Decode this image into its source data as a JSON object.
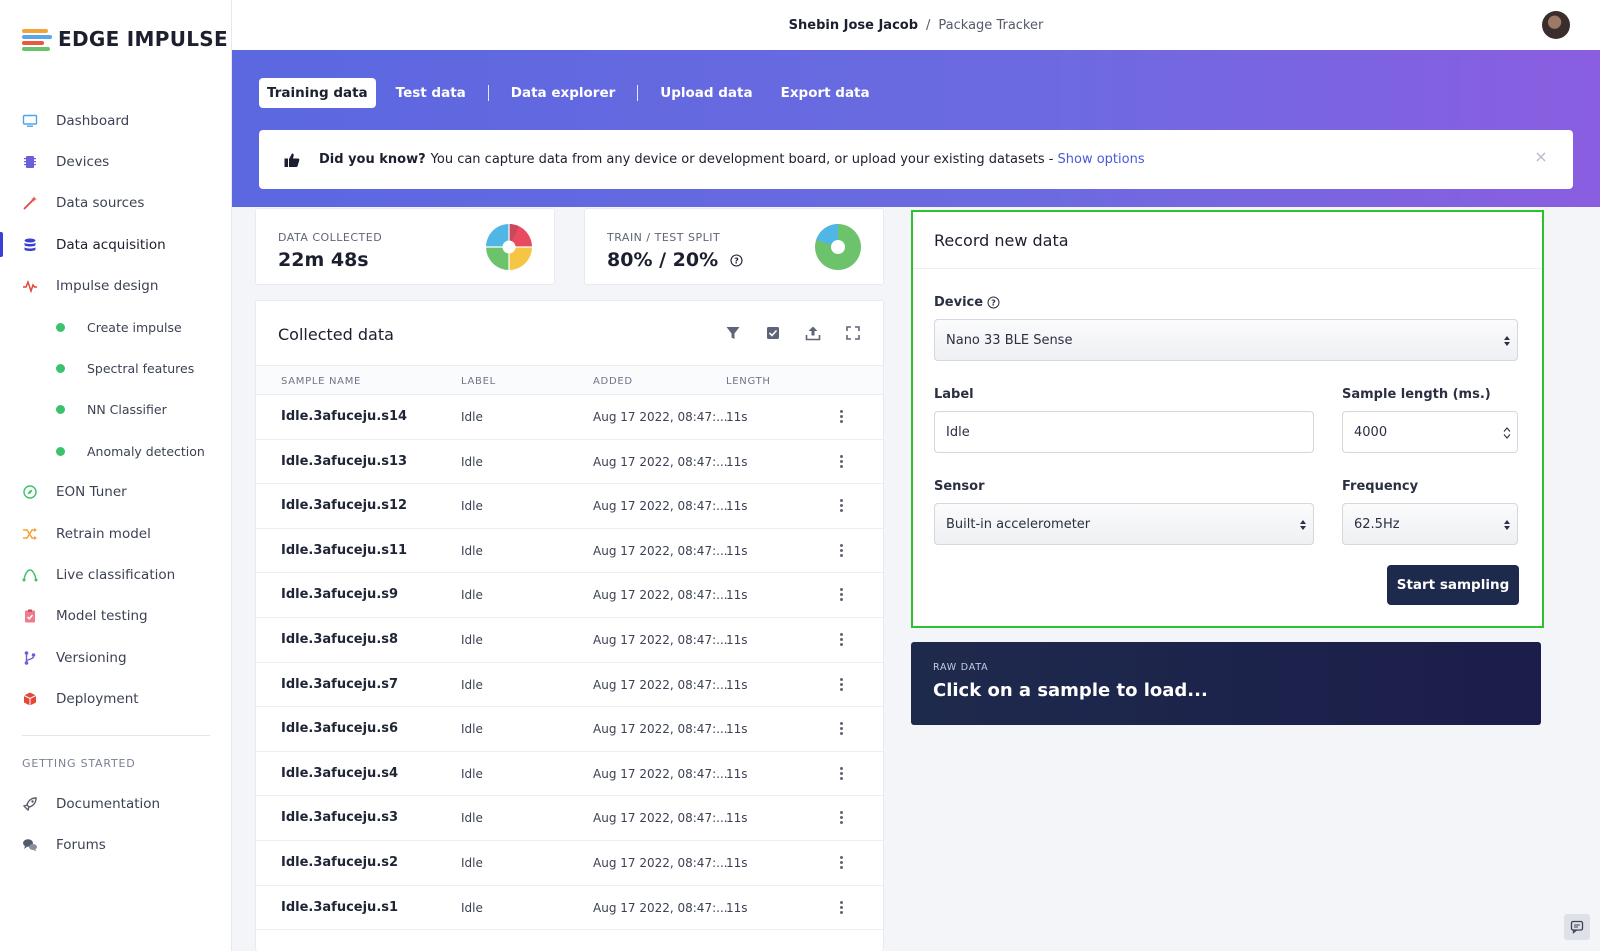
{
  "brand": {
    "name": "EDGE IMPULSE"
  },
  "sidebar": {
    "items": [
      {
        "label": "Dashboard"
      },
      {
        "label": "Devices"
      },
      {
        "label": "Data sources"
      },
      {
        "label": "Data acquisition"
      },
      {
        "label": "Impulse design"
      },
      {
        "label": "Create impulse"
      },
      {
        "label": "Spectral features"
      },
      {
        "label": "NN Classifier"
      },
      {
        "label": "Anomaly detection"
      },
      {
        "label": "EON Tuner"
      },
      {
        "label": "Retrain model"
      },
      {
        "label": "Live classification"
      },
      {
        "label": "Model testing"
      },
      {
        "label": "Versioning"
      },
      {
        "label": "Deployment"
      }
    ],
    "section_title": "GETTING STARTED",
    "getting_started": [
      {
        "label": "Documentation"
      },
      {
        "label": "Forums"
      }
    ]
  },
  "breadcrumb": {
    "user": "Shebin Jose Jacob",
    "separator": "/",
    "project": "Package Tracker"
  },
  "tabs": [
    {
      "label": "Training data"
    },
    {
      "label": "Test data"
    },
    {
      "label": "Data explorer"
    },
    {
      "label": "Upload data"
    },
    {
      "label": "Export data"
    }
  ],
  "tip": {
    "strong": "Did you know?",
    "text": "You can capture data from any device or development board, or upload your existing datasets -",
    "link": "Show options",
    "close": "×"
  },
  "stats": {
    "collected": {
      "label": "DATA COLLECTED",
      "value": "22m 48s"
    },
    "split": {
      "label": "TRAIN / TEST SPLIT",
      "value": "80% / 20%",
      "train_fraction": 0.8
    }
  },
  "collected": {
    "title": "Collected data",
    "columns": [
      "SAMPLE NAME",
      "LABEL",
      "ADDED",
      "LENGTH"
    ],
    "rows": [
      {
        "name": "Idle.3afuceju.s14",
        "label": "Idle",
        "added": "Aug 17 2022, 08:47:...",
        "length": "11s"
      },
      {
        "name": "Idle.3afuceju.s13",
        "label": "Idle",
        "added": "Aug 17 2022, 08:47:...",
        "length": "11s"
      },
      {
        "name": "Idle.3afuceju.s12",
        "label": "Idle",
        "added": "Aug 17 2022, 08:47:...",
        "length": "11s"
      },
      {
        "name": "Idle.3afuceju.s11",
        "label": "Idle",
        "added": "Aug 17 2022, 08:47:...",
        "length": "11s"
      },
      {
        "name": "Idle.3afuceju.s9",
        "label": "Idle",
        "added": "Aug 17 2022, 08:47:...",
        "length": "11s"
      },
      {
        "name": "Idle.3afuceju.s8",
        "label": "Idle",
        "added": "Aug 17 2022, 08:47:...",
        "length": "11s"
      },
      {
        "name": "Idle.3afuceju.s7",
        "label": "Idle",
        "added": "Aug 17 2022, 08:47:...",
        "length": "11s"
      },
      {
        "name": "Idle.3afuceju.s6",
        "label": "Idle",
        "added": "Aug 17 2022, 08:47:...",
        "length": "11s"
      },
      {
        "name": "Idle.3afuceju.s4",
        "label": "Idle",
        "added": "Aug 17 2022, 08:47:...",
        "length": "11s"
      },
      {
        "name": "Idle.3afuceju.s3",
        "label": "Idle",
        "added": "Aug 17 2022, 08:47:...",
        "length": "11s"
      },
      {
        "name": "Idle.3afuceju.s2",
        "label": "Idle",
        "added": "Aug 17 2022, 08:47:...",
        "length": "11s"
      },
      {
        "name": "Idle.3afuceju.s1",
        "label": "Idle",
        "added": "Aug 17 2022, 08:47:...",
        "length": "11s"
      }
    ]
  },
  "record": {
    "title": "Record new data",
    "device_label": "Device",
    "device_value": "Nano 33 BLE Sense",
    "label_label": "Label",
    "label_value": "Idle",
    "length_label": "Sample length (ms.)",
    "length_value": "4000",
    "sensor_label": "Sensor",
    "sensor_value": "Built-in accelerometer",
    "frequency_label": "Frequency",
    "frequency_value": "62.5Hz",
    "start_button": "Start sampling"
  },
  "raw": {
    "label": "RAW DATA",
    "text": "Click on a sample to load..."
  },
  "colors": {
    "accent": "#3b3fd8",
    "banner_start": "#5b68e0",
    "banner_end": "#8a5ee0",
    "highlight": "#2ec12e",
    "dark": "#1e2a4c"
  }
}
